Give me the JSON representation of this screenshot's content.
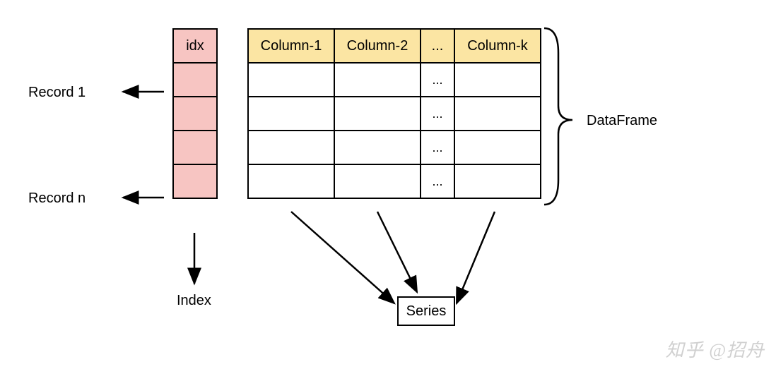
{
  "labels": {
    "record1": "Record 1",
    "recordn": "Record n",
    "index": "Index",
    "dataframe": "DataFrame",
    "series": "Series",
    "idx": "idx"
  },
  "columns": [
    "Column-1",
    "Column-2",
    "...",
    "Column-k"
  ],
  "ellipsis": "...",
  "watermark": "知乎 @招舟",
  "colors": {
    "index_bg": "#f7c5c2",
    "header_bg": "#fbe5a3"
  }
}
